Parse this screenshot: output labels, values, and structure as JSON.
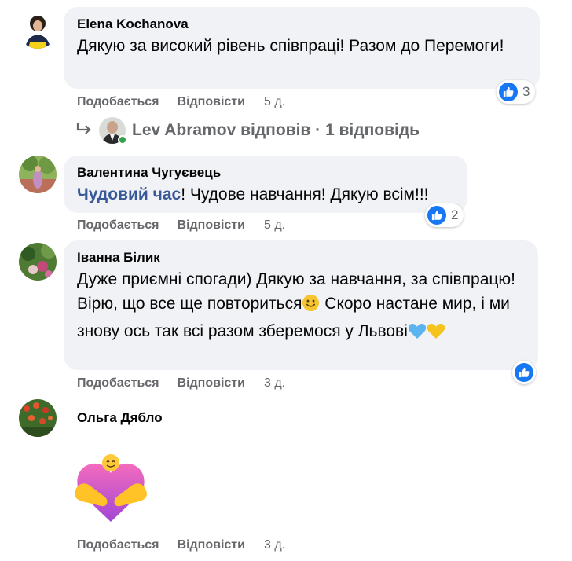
{
  "comments": [
    {
      "author": "Elena Kochanova",
      "text": "Дякую за високий рівень співпраці! Разом до Перемоги!",
      "reaction_count": "3",
      "actions": {
        "like": "Подобається",
        "reply": "Відповісти",
        "time": "5 д."
      },
      "reply_summary": {
        "text": "Lev Abramov відповів · 1 відповідь"
      }
    },
    {
      "author": "Валентина Чугуєвець",
      "mention": "Чудовий час",
      "text": "! Чудове навчання! Дякую всім!!!",
      "reaction_count": "2",
      "actions": {
        "like": "Подобається",
        "reply": "Відповісти",
        "time": "5 д."
      }
    },
    {
      "author": "Іванна Білик",
      "text": "Дуже приємні спогади) Дякую за навчання, за співпрацю! Вірю, що все ще повториться",
      "text_after_smile": " Скоро настане мир, і ми знову ось так всі разом зберемося у Львові",
      "actions": {
        "like": "Подобається",
        "reply": "Відповісти",
        "time": "3 д."
      }
    },
    {
      "author": "Ольга Дябло",
      "sticker": "heart-hug-sticker",
      "actions": {
        "like": "Подобається",
        "reply": "Відповісти",
        "time": "3 д."
      }
    }
  ],
  "colors": {
    "bubble": "#f0f2f5",
    "like_blue": "#1877f2",
    "meta_gray": "#65676b",
    "online_green": "#31a24c"
  }
}
